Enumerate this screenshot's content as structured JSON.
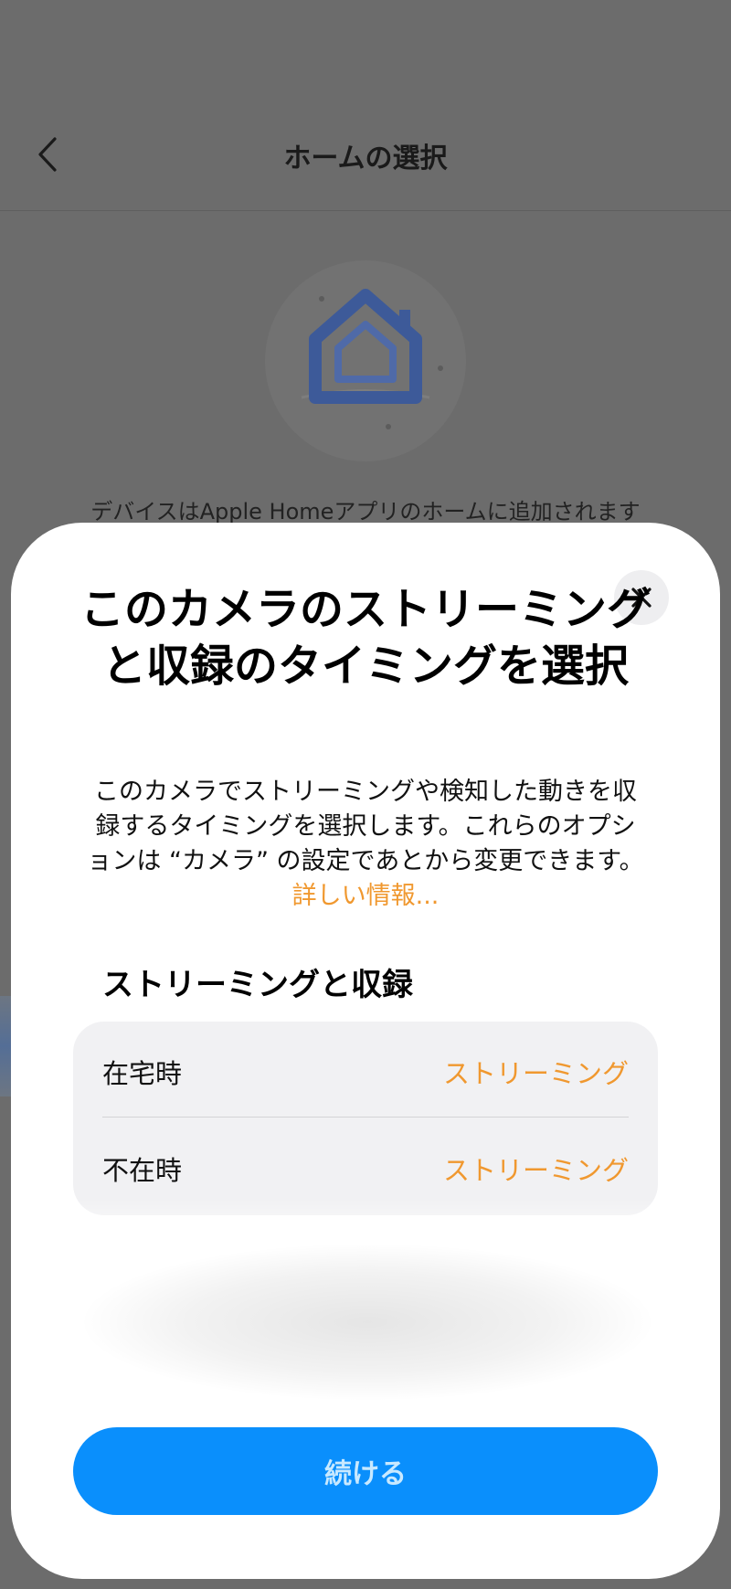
{
  "background_screen": {
    "title": "ホームの選択",
    "back_icon": "chevron-left-icon",
    "illustration_icon": "home-icon",
    "description": "デバイスはApple Homeアプリのホームに追加されます"
  },
  "sheet": {
    "close_icon": "close-icon",
    "title": "このカメラのストリーミングと収録のタイミングを選択",
    "description": "このカメラでストリーミングや検知した動きを収録するタイミングを選択します。これらのオプションは “カメラ” の設定であとから変更できます。 ",
    "learn_more": "詳しい情報...",
    "section_heading": "ストリーミングと収録",
    "rows": [
      {
        "label": "在宅時",
        "value": "ストリーミング"
      },
      {
        "label": "不在時",
        "value": "ストリーミング"
      }
    ],
    "continue_label": "続ける"
  },
  "colors": {
    "accent": "#f0982f",
    "primary_button": "#0a8ffc",
    "overlay": "#6c6c6c"
  }
}
